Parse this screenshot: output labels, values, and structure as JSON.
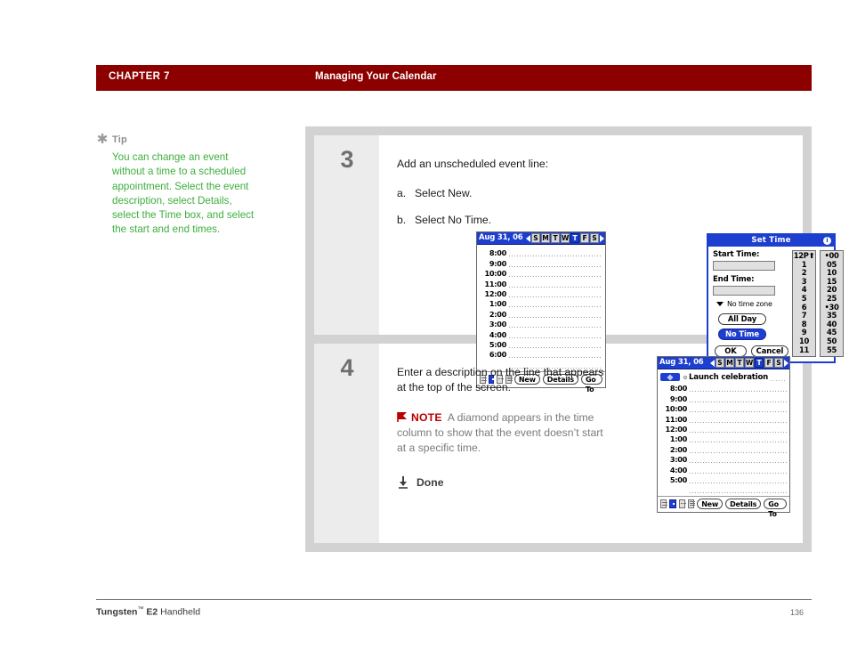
{
  "header": {
    "chapter_label": "CHAPTER 7",
    "chapter_title": "Managing Your Calendar"
  },
  "tip": {
    "star_glyph": "✱",
    "label": "Tip",
    "body": "You can change an event without a time to a scheduled appointment. Select the event description, select Details, select the Time box, and select the start and end times."
  },
  "steps": [
    {
      "number": "3",
      "intro": "Add an unscheduled event line:",
      "substeps": [
        {
          "marker": "a.",
          "text": "Select New."
        },
        {
          "marker": "b.",
          "text": "Select No Time."
        }
      ]
    },
    {
      "number": "4",
      "intro": "Enter a description on the line that appears at the top of the screen.",
      "note_label": "NOTE",
      "note_text": "A diamond appears in the time column to show that the event doesn’t start at a specific time.",
      "done_label": "Done"
    }
  ],
  "calendar_before": {
    "date": "Aug 31, 06",
    "prev_glyph": "◀",
    "next_glyph": "▶",
    "days": [
      "S",
      "M",
      "T",
      "W",
      "T",
      "F",
      "S"
    ],
    "selected_day_index": 4,
    "times": [
      "8:00",
      "9:00",
      "10:00",
      "11:00",
      "12:00",
      "1:00",
      "2:00",
      "3:00",
      "4:00",
      "5:00",
      "6:00"
    ],
    "buttons": [
      "New",
      "Details",
      "Go To"
    ],
    "view_icons": [
      "day-view-icon",
      "week-view-icon",
      "month-view-icon",
      "agenda-view-icon"
    ],
    "selected_view_index": 1
  },
  "calendar_after": {
    "date": "Aug 31, 06",
    "prev_glyph": "◀",
    "next_glyph": "▶",
    "days": [
      "S",
      "M",
      "T",
      "W",
      "T",
      "F",
      "S"
    ],
    "selected_day_index": 4,
    "event_title": "Launch celebration",
    "times": [
      "8:00",
      "9:00",
      "10:00",
      "11:00",
      "12:00",
      "1:00",
      "2:00",
      "3:00",
      "4:00",
      "5:00"
    ],
    "buttons": [
      "New",
      "Details",
      "Go To"
    ],
    "view_icons": [
      "day-view-icon",
      "week-view-icon",
      "month-view-icon",
      "agenda-view-icon"
    ],
    "selected_view_index": 1
  },
  "set_time_dialog": {
    "title": "Set Time",
    "info_glyph": "i",
    "start_label": "Start Time:",
    "start_value": "",
    "end_label": "End Time:",
    "end_value": "",
    "timezone_text": "No time zone",
    "all_day_label": "All Day",
    "no_time_label": "No Time",
    "no_time_selected": true,
    "ok_label": "OK",
    "cancel_label": "Cancel",
    "hours": [
      "12P⬆",
      "1",
      "2",
      "3",
      "4",
      "5",
      "6",
      "7",
      "8",
      "9",
      "10",
      "11"
    ],
    "minutes": [
      "•00",
      "05",
      "10",
      "15",
      "20",
      "25",
      "•30",
      "35",
      "40",
      "45",
      "50",
      "55"
    ]
  },
  "footer": {
    "product": "Tungsten",
    "trademark": "™",
    "model": " E2",
    "product_suffix": " Handheld",
    "page": "136"
  },
  "colors": {
    "chapter_bar": "#8c0000",
    "tip_text": "#3dae3d",
    "note_red": "#b80000",
    "palm_blue": "#1d3fd0",
    "step_panel": "#d2d2d2",
    "step_number_col": "#ececec"
  }
}
